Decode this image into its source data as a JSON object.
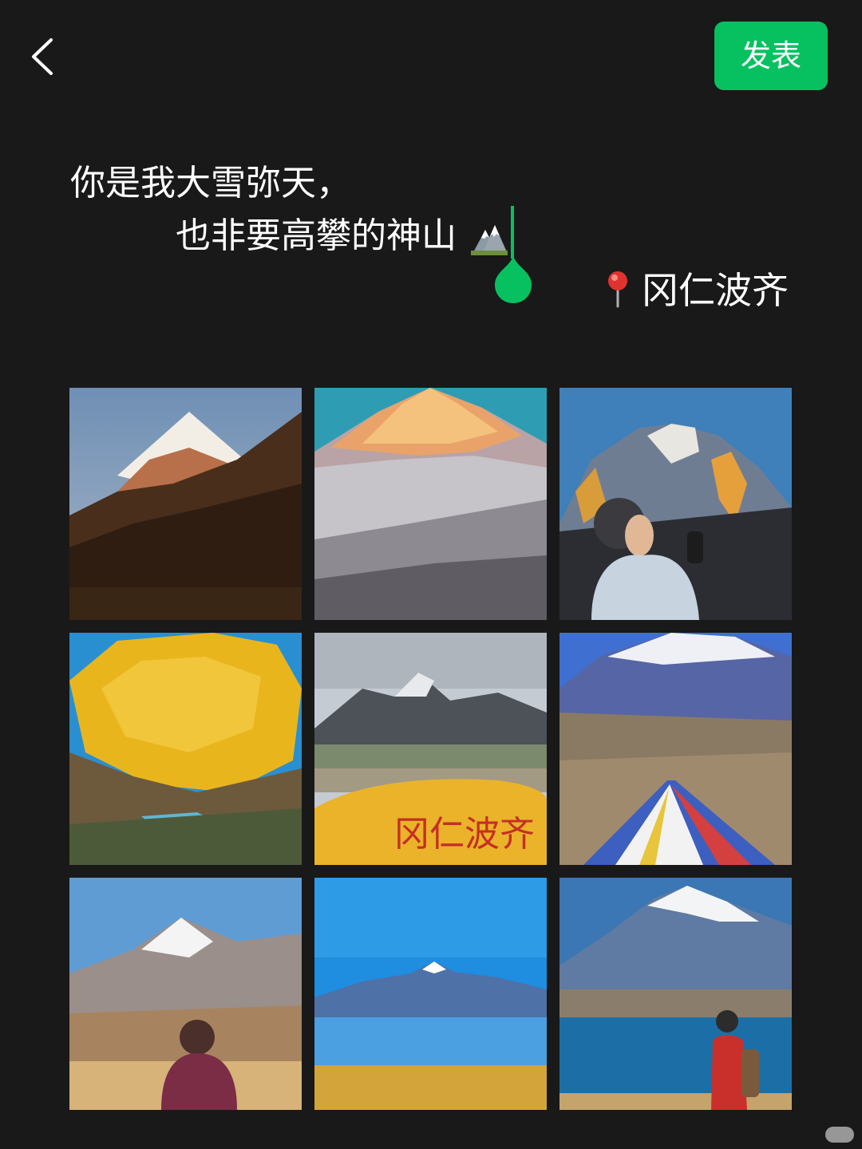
{
  "header": {
    "publish_label": "发表"
  },
  "post": {
    "line1": "你是我大雪弥天，",
    "line2": "也非要高攀的神山",
    "line2_emoji": "mountain-emoji",
    "location": "冈仁波齐",
    "location_icon": "round-pushpin-icon"
  },
  "photos": [
    {
      "name": "photo-1",
      "scene": "snow peak above dark ridge at sunset"
    },
    {
      "name": "photo-2",
      "scene": "golden-lit snow mountain face close-up"
    },
    {
      "name": "photo-3",
      "scene": "woman in beanie looking up at sunlit peak"
    },
    {
      "name": "photo-4",
      "scene": "golden glowing mountain face above lake"
    },
    {
      "name": "photo-5",
      "scene": "yellow stone with red carved text in front of mountain"
    },
    {
      "name": "photo-6",
      "scene": "prayer flags tent below snowy mountain"
    },
    {
      "name": "photo-7",
      "scene": "person with cap facing snow peak"
    },
    {
      "name": "photo-8",
      "scene": "snow peak across blue lake with reflection"
    },
    {
      "name": "photo-9",
      "scene": "hiker with backpack beside lake and mountain"
    }
  ],
  "photo5_carving": "冈仁波齐",
  "colors": {
    "background": "#191919",
    "accent_green": "#07c160",
    "text": "#ffffff"
  }
}
